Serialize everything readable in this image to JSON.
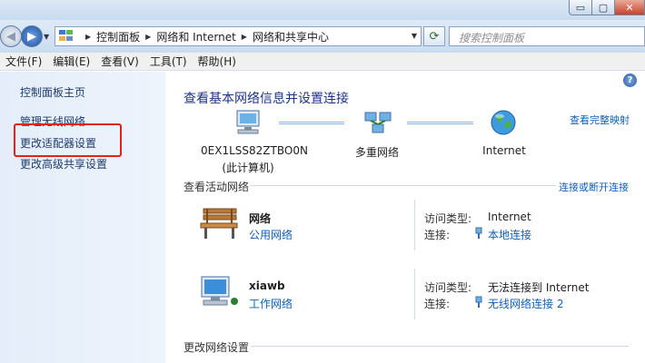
{
  "window": {
    "controls": {
      "minimize": "▭",
      "maximize": "▢",
      "close": "✕"
    }
  },
  "address": {
    "breadcrumbs": [
      "控制面板",
      "网络和 Internet",
      "网络和共享中心"
    ],
    "search_placeholder": "搜索控制面板"
  },
  "menu": [
    "文件(F)",
    "编辑(E)",
    "查看(V)",
    "工具(T)",
    "帮助(H)"
  ],
  "sidebar": {
    "items": [
      {
        "label": "控制面板主页"
      },
      {
        "label": "管理无线网络"
      },
      {
        "label": "更改适配器设置"
      },
      {
        "label": "更改高级共享设置"
      }
    ]
  },
  "main": {
    "heading": "查看基本网络信息并设置连接",
    "view_full_map": "查看完整映射",
    "help": "?",
    "map": {
      "computer_name": "0EX1LSS82ZTBO0N",
      "computer_sub": "(此计算机)",
      "middle": "多重网络",
      "right": "Internet"
    },
    "active_title": "查看活动网络",
    "connect_disconnect": "连接或断开连接",
    "networks": [
      {
        "name": "网络",
        "type": "公用网络",
        "access_label": "访问类型:",
        "access_value": "Internet",
        "conn_label": "连接:",
        "conn_value": "本地连接"
      },
      {
        "name": "xiawb",
        "type": "工作网络",
        "access_label": "访问类型:",
        "access_value": "无法连接到 Internet",
        "conn_label": "连接:",
        "conn_value": "无线网络连接 2"
      }
    ],
    "change_settings_title": "更改网络设置"
  },
  "colors": {
    "link": "#0f5fb3",
    "heading": "#1e3287",
    "highlight": "#e0231c"
  }
}
